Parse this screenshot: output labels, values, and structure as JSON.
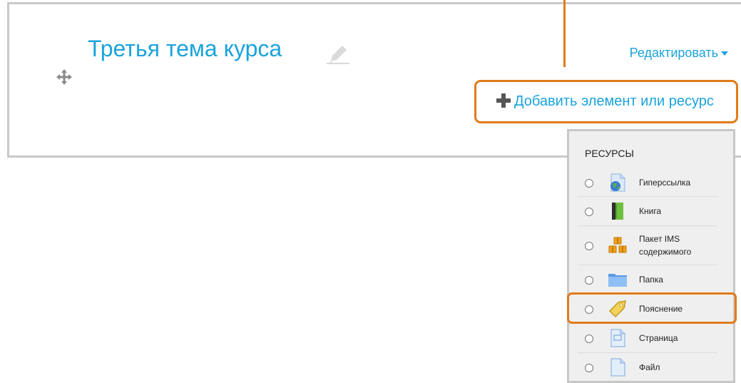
{
  "section": {
    "title": "Третья тема курса",
    "edit_menu_label": "Редактировать",
    "add_activity_label": "Добавить элемент или ресурс"
  },
  "chooser": {
    "heading": "РЕСУРСЫ",
    "items": [
      {
        "label": "Гиперссылка",
        "icon": "url-globe-icon"
      },
      {
        "label": "Книга",
        "icon": "book-icon"
      },
      {
        "label": "Пакет IMS содержимого",
        "icon": "ims-package-icon"
      },
      {
        "label": "Папка",
        "icon": "folder-icon"
      },
      {
        "label": "Пояснение",
        "icon": "label-tag-icon",
        "highlighted": true
      },
      {
        "label": "Страница",
        "icon": "page-icon"
      },
      {
        "label": "Файл",
        "icon": "file-icon"
      }
    ]
  },
  "colors": {
    "link": "#1aa3db",
    "callout": "#e07b1a",
    "border": "#c9c9c9",
    "chooser_bg": "#efefef"
  }
}
